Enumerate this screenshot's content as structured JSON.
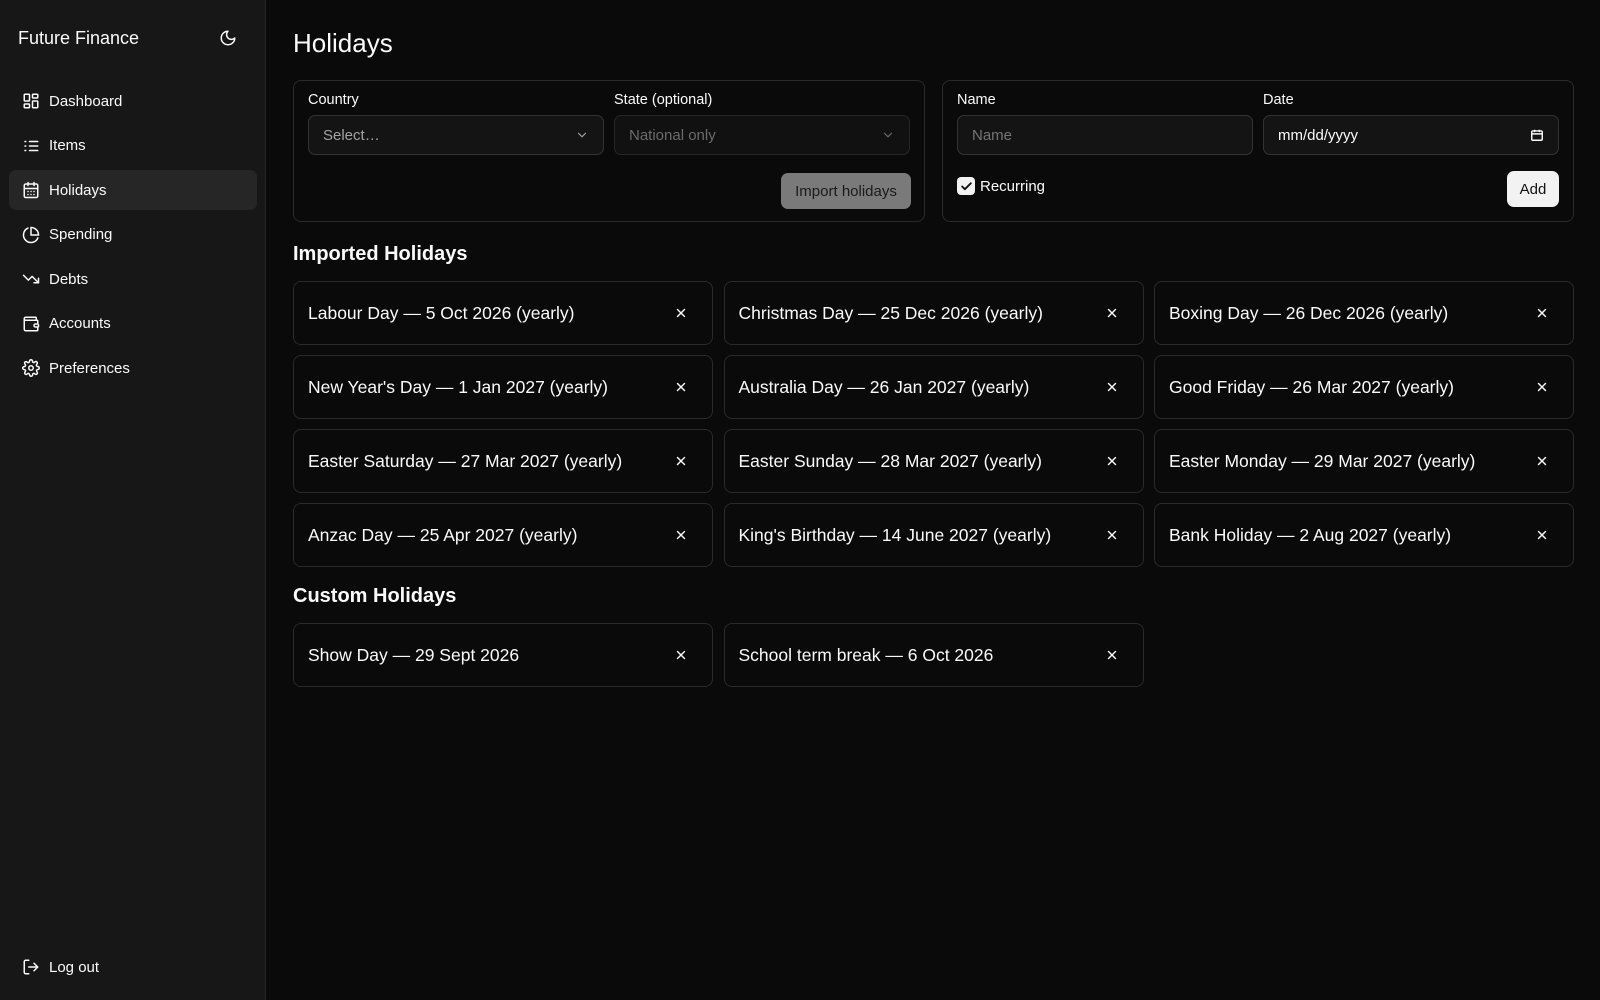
{
  "sidebar": {
    "brand": "Future Finance",
    "theme_icon": "moon-icon",
    "items": [
      {
        "label": "Dashboard",
        "icon": "dashboard-icon"
      },
      {
        "label": "Items",
        "icon": "list-icon"
      },
      {
        "label": "Holidays",
        "icon": "calendar-icon",
        "active": true
      },
      {
        "label": "Spending",
        "icon": "pie-chart-icon"
      },
      {
        "label": "Debts",
        "icon": "trending-down-icon"
      },
      {
        "label": "Accounts",
        "icon": "wallet-icon"
      },
      {
        "label": "Preferences",
        "icon": "gear-icon"
      }
    ],
    "logout_label": "Log out"
  },
  "page": {
    "title": "Holidays"
  },
  "import_form": {
    "country_label": "Country",
    "country_value": "Select…",
    "state_label": "State (optional)",
    "state_value": "National only",
    "import_button": "Import holidays"
  },
  "add_form": {
    "name_label": "Name",
    "name_placeholder": "Name",
    "date_label": "Date",
    "date_value": "mm/dd/yyyy",
    "recurring_label": "Recurring",
    "recurring_checked": true,
    "add_button": "Add"
  },
  "imported": {
    "title": "Imported Holidays",
    "items": [
      "Labour Day — 5 Oct 2026 (yearly)",
      "Christmas Day — 25 Dec 2026 (yearly)",
      "Boxing Day — 26 Dec 2026 (yearly)",
      "New Year's Day — 1 Jan 2027 (yearly)",
      "Australia Day — 26 Jan 2027 (yearly)",
      "Good Friday — 26 Mar 2027 (yearly)",
      "Easter Saturday — 27 Mar 2027 (yearly)",
      "Easter Sunday — 28 Mar 2027 (yearly)",
      "Easter Monday — 29 Mar 2027 (yearly)",
      "Anzac Day — 25 Apr 2027 (yearly)",
      "King's Birthday — 14 June 2027 (yearly)",
      "Bank Holiday — 2 Aug 2027 (yearly)"
    ]
  },
  "custom": {
    "title": "Custom Holidays",
    "items": [
      "Show Day — 29 Sept 2026",
      "School term break — 6 Oct 2026"
    ]
  },
  "colors": {
    "background": "#0a0a0a",
    "sidebar": "#171717",
    "active_item": "#262626",
    "border": "#2a2a2a",
    "text": "#fafafa"
  }
}
